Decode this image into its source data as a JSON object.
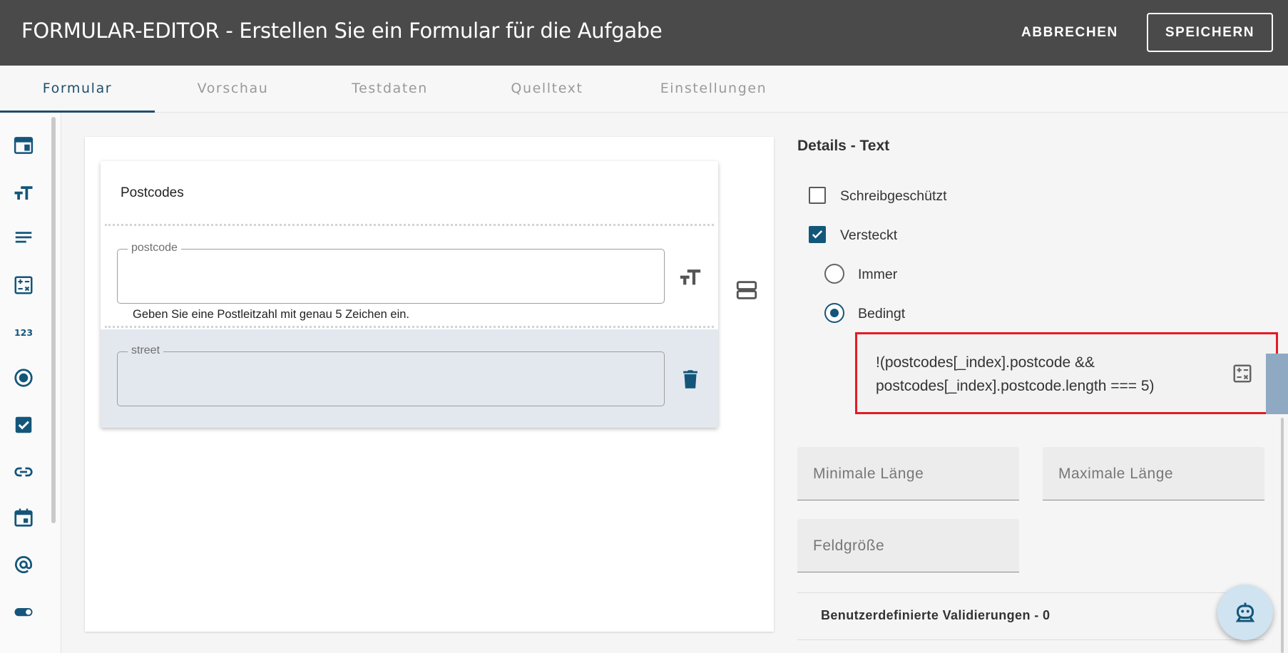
{
  "header": {
    "title": "FORMULAR-EDITOR - Erstellen Sie ein Formular für die Aufgabe",
    "cancel_label": "ABBRECHEN",
    "save_label": "SPEICHERN"
  },
  "tabs": [
    "Formular",
    "Vorschau",
    "Testdaten",
    "Quelltext",
    "Einstellungen"
  ],
  "active_tab": "Formular",
  "sidebar_tools": [
    "panel-icon",
    "text-size-icon",
    "textarea-icon",
    "calculator-icon",
    "number-icon",
    "radio-icon",
    "checkbox-icon",
    "link-icon",
    "calendar-icon",
    "email-icon",
    "toggle-icon"
  ],
  "form": {
    "card_title": "Postcodes",
    "fields": [
      {
        "label": "postcode",
        "hint": "Geben Sie eine Postleitzahl mit genau 5 Zeichen ein."
      },
      {
        "label": "street",
        "hint": ""
      }
    ]
  },
  "details": {
    "title": "Details - Text",
    "readonly_label": "Schreibgeschützt",
    "readonly_checked": false,
    "hidden_label": "Versteckt",
    "hidden_checked": true,
    "always_label": "Immer",
    "conditional_label": "Bedingt",
    "selected_mode": "Bedingt",
    "expression_line1": "!(postcodes[_index].postcode &&",
    "expression_line2": "postcodes[_index].postcode.length === 5)",
    "min_length_placeholder": "Minimale Länge",
    "max_length_placeholder": "Maximale Länge",
    "field_size_placeholder": "Feldgröße",
    "validations_label": "Benutzerdefinierte Validierungen - 0"
  },
  "colors": {
    "header_bg": "#4a4a4a",
    "accent": "#14567a",
    "highlight_border": "#e31b23",
    "selected_row_bg": "#e3e8ef"
  }
}
